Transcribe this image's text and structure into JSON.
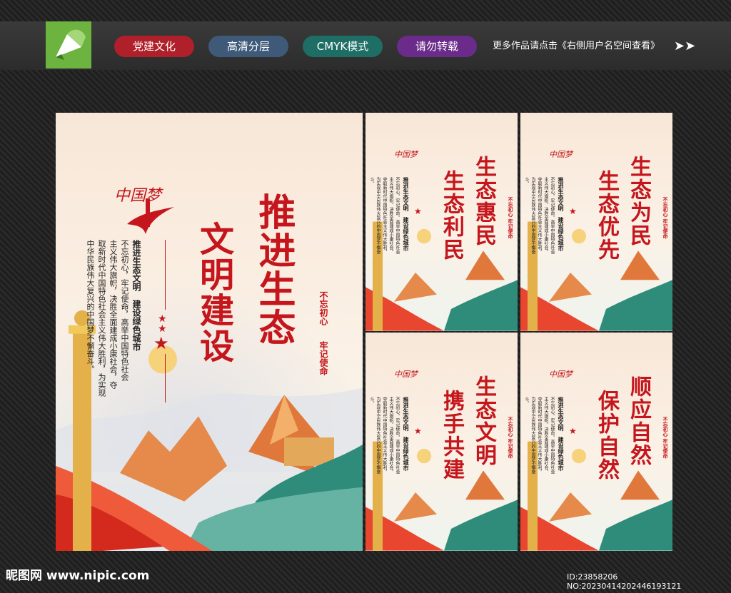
{
  "tags": [
    "党建文化",
    "高清分层",
    "CMYK模式",
    "请勿转载"
  ],
  "more_text": "更多作品请点击《右侧用户名空间查看》",
  "main": {
    "title_right": "推进生态",
    "title_left": "文明建设",
    "body_heading": "推进生态文明　建设绿色城市",
    "body_lines": [
      "不忘初心，牢记使命，高举中国特色社会",
      "主义伟大旗帜，决胜全面建成小康社会，夺",
      "取新时代中国特色社会主义伟大胜利，为实现",
      "中华民族伟大复兴的中国梦不懈奋斗。"
    ],
    "slogan_1": "不忘初心",
    "slogan_2": "牢记使命",
    "brand": "中国梦"
  },
  "small_posters": [
    {
      "line_right": "生态惠民",
      "line_left": "生态利民"
    },
    {
      "line_right": "生态为民",
      "line_left": "生态优先"
    },
    {
      "line_right": "生态文明",
      "line_left": "携手共建"
    },
    {
      "line_right": "顺应自然",
      "line_left": "保护自然"
    }
  ],
  "small_body_heading": "推进生态文明　建设绿色城市",
  "small_body_text": "不忘初心，牢记使命，高举中国特色社会主义伟大旗帜，决胜全面建成小康社会，夺取新时代中国特色社会主义伟大胜利，为实现中华民族伟大复兴的中国梦不懈奋斗。",
  "small_slogan": "不忘初心 牢记使命",
  "footer_left": "昵图网 www.nipic.com",
  "footer_right": "ID:23858206 NO:20230414202446193121"
}
